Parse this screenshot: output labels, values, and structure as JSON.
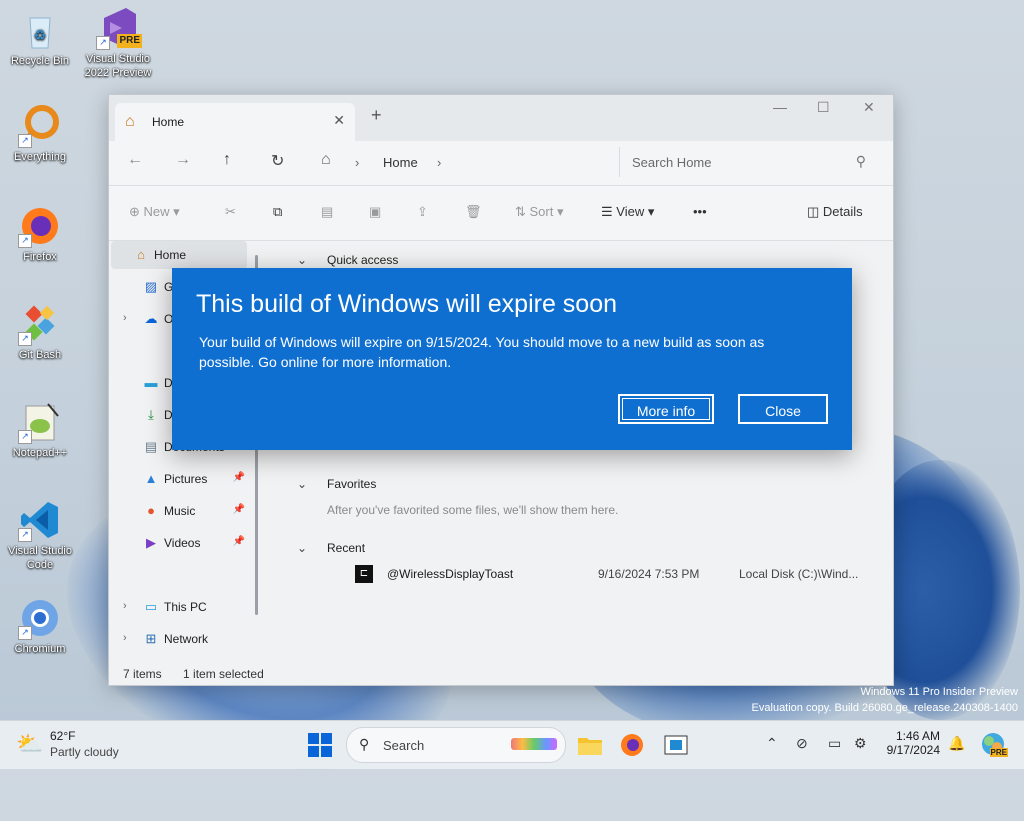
{
  "desktop": {
    "icons": [
      {
        "label": "Recycle Bin"
      },
      {
        "label": "Visual Studio 2022 Preview",
        "badge": "PRE"
      },
      {
        "label": "Everything"
      },
      {
        "label": "Firefox"
      },
      {
        "label": "Git Bash"
      },
      {
        "label": "Notepad++"
      },
      {
        "label": "Visual Studio Code"
      },
      {
        "label": "Chromium"
      }
    ],
    "watermark": {
      "line1": "Windows 11 Pro Insider Preview",
      "line2": "Evaluation copy. Build 26080.ge_release.240308-1400"
    }
  },
  "explorer": {
    "tab_title": "Home",
    "new_tab": "+",
    "window_controls": {
      "minimize": "—",
      "maximize": "☐",
      "close": "✕"
    },
    "breadcrumb": [
      "Home"
    ],
    "search_placeholder": "Search Home",
    "toolbar": {
      "new": "New",
      "sort": "Sort",
      "view": "View",
      "more": "•••",
      "details": "Details"
    },
    "sidebar": [
      {
        "label": "Home",
        "icon": "home-icon"
      },
      {
        "label": "G",
        "icon": "gallery-icon"
      },
      {
        "label": "O",
        "icon": "onedrive-icon"
      },
      {
        "label": "D",
        "icon": "desktop-folder-icon"
      },
      {
        "label": "D",
        "icon": "downloads-icon"
      },
      {
        "label": "Documents",
        "icon": "documents-icon"
      },
      {
        "label": "Pictures",
        "icon": "pictures-icon"
      },
      {
        "label": "Music",
        "icon": "music-icon"
      },
      {
        "label": "Videos",
        "icon": "videos-icon"
      },
      {
        "label": "This PC",
        "icon": "pc-icon"
      },
      {
        "label": "Network",
        "icon": "network-icon"
      }
    ],
    "sections": {
      "quick_access": "Quick access",
      "favorites": "Favorites",
      "favorites_empty": "After you've favorited some files, we'll show them here.",
      "recent": "Recent"
    },
    "recent_files": [
      {
        "name": "@WirelessDisplayToast",
        "date": "9/16/2024 7:53 PM",
        "location": "Local Disk (C:)\\Wind..."
      }
    ],
    "status": {
      "items": "7 items",
      "selected": "1 item selected"
    }
  },
  "dialog": {
    "title": "This build of Windows will expire soon",
    "message": "Your build of Windows will expire on 9/15/2024. You should move to a new build as soon as possible. Go online for more information.",
    "more_info": "More info",
    "close": "Close",
    "color": "#0f6fd1"
  },
  "taskbar": {
    "weather_temp": "62°F",
    "weather_desc": "Partly cloudy",
    "search_label": "Search",
    "time": "1:46 AM",
    "date": "9/17/2024",
    "copilot_badge": "PRE"
  }
}
